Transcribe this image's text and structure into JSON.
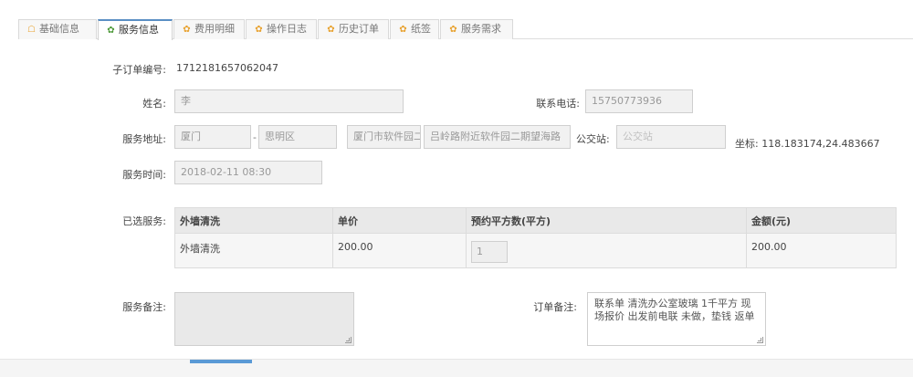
{
  "tabs": [
    {
      "label": "基础信息",
      "icon": "home-icon",
      "glyph": "🏠"
    },
    {
      "label": "服务信息",
      "icon": "gear-icon",
      "glyph": "✿",
      "active": true
    },
    {
      "label": "费用明细",
      "icon": "gear-icon",
      "glyph": "✿"
    },
    {
      "label": "操作日志",
      "icon": "gear-icon",
      "glyph": "✿"
    },
    {
      "label": "历史订单",
      "icon": "gear-icon",
      "glyph": "✿"
    },
    {
      "label": "纸签",
      "icon": "gear-icon",
      "glyph": "✿"
    },
    {
      "label": "服务需求",
      "icon": "gear-icon",
      "glyph": "✿"
    }
  ],
  "suborder": {
    "label": "子订单编号:",
    "value": "1712181657062047"
  },
  "name": {
    "label": "姓名:",
    "value": "李"
  },
  "phone": {
    "label": "联系电话:",
    "value": "15750773936"
  },
  "address": {
    "label": "服务地址:",
    "city": "厦门",
    "separator": "-",
    "district": "思明区",
    "area": "厦门市软件园二",
    "detail": "吕岭路附近软件园二期望海路",
    "bus_label": "公交站:",
    "bus_placeholder": "公交站",
    "coord_text": "坐标: 118.183174,24.483667"
  },
  "service_time": {
    "label": "服务时间:",
    "value": "2018-02-11 08:30"
  },
  "selected_services": {
    "label": "已选服务:",
    "columns": [
      "外墙清洗",
      "单价",
      "预约平方数(平方)",
      "金额(元)"
    ],
    "rows": [
      {
        "service": "外墙清洗",
        "price": "200.00",
        "qty": "1",
        "amount": "200.00"
      }
    ]
  },
  "service_note": {
    "label": "服务备注:",
    "value": ""
  },
  "order_note": {
    "label": "订单备注:",
    "value": "联系单 清洗办公室玻璃 1千平方 现场报价 出发前电联 未做，垫钱 返单"
  },
  "colors": {
    "active_tab_border": "#5a8fc4",
    "tab_icon": "#e8a230",
    "active_icon": "#4e9a3a",
    "footer_button": "#5a9ad6"
  }
}
